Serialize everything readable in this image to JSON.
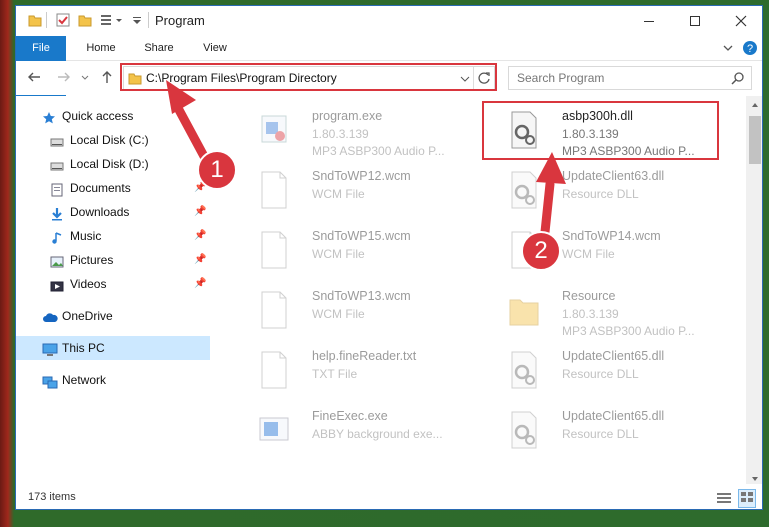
{
  "window": {
    "title": "Program"
  },
  "ribbon": {
    "tabs": [
      "File",
      "Home",
      "Share",
      "View"
    ]
  },
  "address": {
    "path": "C:\\Program Files\\Program Directory"
  },
  "search": {
    "placeholder": "Search Program"
  },
  "sidebar": {
    "items": [
      {
        "label": "Quick access",
        "icon": "star-icon"
      },
      {
        "label": "Local Disk (C:)",
        "icon": "drive-icon"
      },
      {
        "label": "Local Disk (D:)",
        "icon": "drive-icon"
      },
      {
        "label": "Documents",
        "icon": "documents-icon",
        "pinned": true
      },
      {
        "label": "Downloads",
        "icon": "download-icon",
        "pinned": true
      },
      {
        "label": "Music",
        "icon": "music-icon",
        "pinned": true
      },
      {
        "label": "Pictures",
        "icon": "pictures-icon",
        "pinned": true
      },
      {
        "label": "Videos",
        "icon": "videos-icon",
        "pinned": true
      },
      {
        "label": "OneDrive",
        "icon": "cloud-icon"
      },
      {
        "label": "This PC",
        "icon": "pc-icon",
        "selected": true
      },
      {
        "label": "Network",
        "icon": "network-icon"
      }
    ]
  },
  "files": [
    {
      "name": "program.exe",
      "line1": "1.80.3.139",
      "line2": "MP3 ASBP300 Audio P...",
      "icon": "exe-icon",
      "faded": true
    },
    {
      "name": "asbp300h.dll",
      "line1": "1.80.3.139",
      "line2": "MP3 ASBP300 Audio P...",
      "icon": "dll-gear-icon",
      "faded": false
    },
    {
      "name": "SndToWP12.wcm",
      "line1": "WCM File",
      "line2": "",
      "icon": "blank-file-icon",
      "faded": true
    },
    {
      "name": "UpdateClient63.dll",
      "line1": "Resource DLL",
      "line2": "",
      "icon": "dll-gear-icon",
      "faded": true
    },
    {
      "name": "SndToWP15.wcm",
      "line1": "WCM File",
      "line2": "",
      "icon": "blank-file-icon",
      "faded": true
    },
    {
      "name": "SndToWP14.wcm",
      "line1": "WCM File",
      "line2": "",
      "icon": "blank-file-icon",
      "faded": true
    },
    {
      "name": "SndToWP13.wcm",
      "line1": "WCM File",
      "line2": "",
      "icon": "blank-file-icon",
      "faded": true
    },
    {
      "name": "Resource",
      "line1": "1.80.3.139",
      "line2": "MP3 ASBP300 Audio P...",
      "icon": "folder-file-icon",
      "faded": true
    },
    {
      "name": "help.fineReader.txt",
      "line1": "TXT File",
      "line2": "",
      "icon": "blank-file-icon",
      "faded": true
    },
    {
      "name": "UpdateClient65.dll",
      "line1": "Resource DLL",
      "line2": "",
      "icon": "dll-gear-icon",
      "faded": true
    },
    {
      "name": "FineExec.exe",
      "line1": "ABBY background exe...",
      "line2": "",
      "icon": "exe-window-icon",
      "faded": true
    },
    {
      "name": "UpdateClient65.dll",
      "line1": "Resource DLL",
      "line2": "",
      "icon": "dll-gear-icon",
      "faded": true
    }
  ],
  "status": {
    "items": "173 items"
  },
  "annotations": {
    "one": "1",
    "two": "2"
  },
  "colors": {
    "accent": "#1979ca",
    "highlight": "#d9363e",
    "selected": "#cce8ff"
  }
}
